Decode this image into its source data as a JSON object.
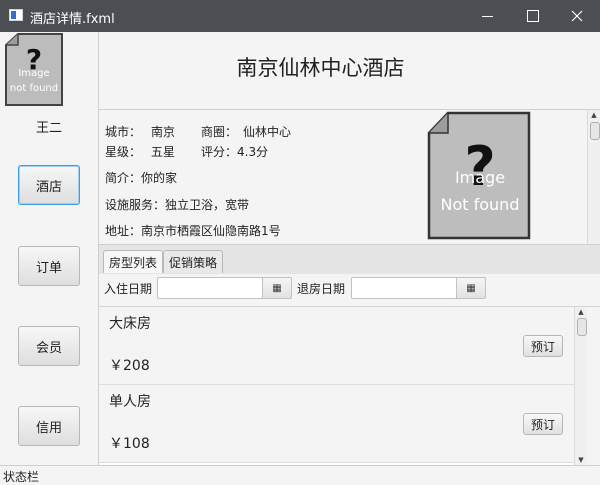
{
  "window": {
    "title": "酒店详情.fxml"
  },
  "sidebar": {
    "avatar_alt_line1": "Image",
    "avatar_alt_line2": "not found",
    "user_name": "王二",
    "items": [
      {
        "label": "酒店",
        "active": true
      },
      {
        "label": "订单",
        "active": false
      },
      {
        "label": "会员",
        "active": false
      },
      {
        "label": "信用",
        "active": false
      }
    ]
  },
  "hotel": {
    "name": "南京仙林中心酒店",
    "city_label": "城市：",
    "city": "南京",
    "district_label": "商圈：",
    "district": "仙林中心",
    "star_label": "星级：",
    "star": "五星",
    "rating_text": "评分：4.3分",
    "intro_text": "简介：你的家",
    "facilities_text": "设施服务：独立卫浴，宽带",
    "address_text": "地址：南京市栖霞区仙隐南路1号",
    "image_alt_line1": "Image",
    "image_alt_line2": "Not found"
  },
  "tabs": [
    {
      "label": "房型列表",
      "selected": true
    },
    {
      "label": "促销策略",
      "selected": false
    }
  ],
  "dates": {
    "checkin_label": "入住日期",
    "checkin_value": "",
    "checkout_label": "退房日期",
    "checkout_value": ""
  },
  "rooms": [
    {
      "name": "大床房",
      "price": "￥208",
      "book_label": "预订"
    },
    {
      "name": "单人房",
      "price": "￥108",
      "book_label": "预订"
    }
  ],
  "status": {
    "text": "状态栏"
  },
  "colors": {
    "titlebar": "#4b4f54",
    "active_focus": "#3b9ee5",
    "background": "#f4f4f4"
  },
  "icons": {
    "app": "app-window-icon",
    "calendar": "calendar-icon",
    "placeholder": "image-not-found-icon"
  }
}
